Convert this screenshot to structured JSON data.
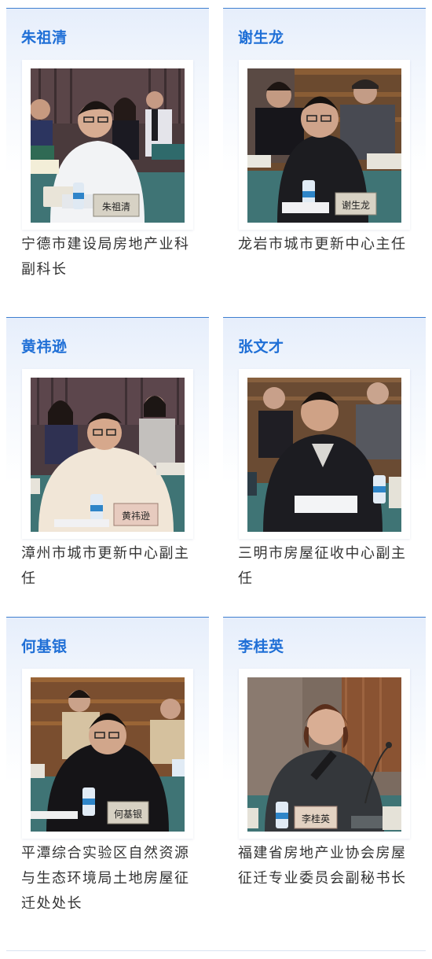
{
  "people": [
    {
      "name": "朱祖清",
      "title": "宁德市建设局房地产业科副科长",
      "placard": "朱祖清",
      "photo_icon": "meeting-photo"
    },
    {
      "name": "谢生龙",
      "title": "龙岩市城市更新中心主任",
      "placard": "谢生龙",
      "photo_icon": "meeting-photo"
    },
    {
      "name": "黄祎逊",
      "title": "漳州市城市更新中心副主任",
      "placard": "黄祎逊",
      "photo_icon": "meeting-photo"
    },
    {
      "name": "张文才",
      "title": "三明市房屋征收中心副主任",
      "placard": "",
      "photo_icon": "meeting-photo"
    },
    {
      "name": "何基银",
      "title": "平潭综合实验区自然资源与生态环境局土地房屋征迁处处长",
      "placard": "何基银",
      "photo_icon": "meeting-photo"
    },
    {
      "name": "李桂英",
      "title": "福建省房地产业协会房屋征迁专业委员会副秘书长",
      "placard": "李桂英",
      "photo_icon": "meeting-photo"
    }
  ],
  "colors": {
    "accent": "#1f6fd6",
    "card_top_border": "#3f7fd0",
    "card_gradient": "#e6eefb",
    "text": "#333333",
    "table": "#3f7475"
  }
}
